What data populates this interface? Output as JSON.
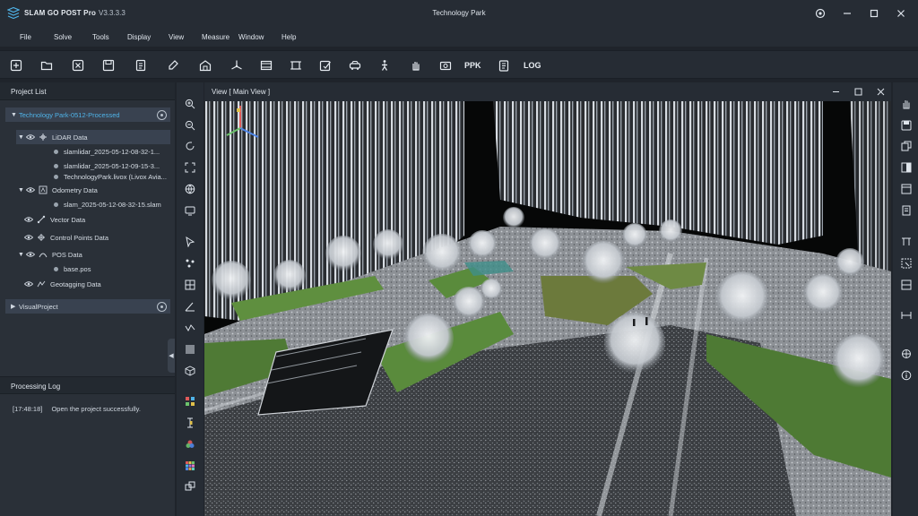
{
  "app": {
    "name": "SLAM GO POST Pro",
    "version": "V3.3.3.3",
    "window_title": "Technology Park"
  },
  "menu": [
    "File",
    "Solve",
    "Tools",
    "Display",
    "View",
    "Measure",
    "Window",
    "Help"
  ],
  "toolbar": {
    "icons": [
      "new-project-icon",
      "open-folder-icon",
      "close-project-icon",
      "save-icon",
      "import-icon",
      "edit-icon",
      "building-icon",
      "coordinate-axes-icon",
      "film-icon",
      "frame-icon",
      "notes-icon",
      "car-icon",
      "walker-icon",
      "hand-icon",
      "camera-icon",
      "clipboard-icon"
    ],
    "ppk_label": "PPK",
    "log_label": "LOG"
  },
  "project_panel": {
    "title": "Project List",
    "root": "Technology Park-0512-Processed",
    "groups": [
      {
        "label": "LiDAR Data",
        "items": [
          "slamlidar_2025-05-12-08-32-1...",
          "slamlidar_2025-05-12-09-15-3...",
          "TechnologyPark.livox (Livox Avia..."
        ]
      },
      {
        "label": "Odometry Data",
        "items": [
          "slam_2025-05-12-08-32-15.slam"
        ]
      },
      {
        "label": "Vector Data",
        "items": []
      },
      {
        "label": "Control Points Data",
        "items": []
      },
      {
        "label": "POS Data",
        "items": [
          "base.pos"
        ]
      },
      {
        "label": "Geotagging Data",
        "items": []
      }
    ],
    "second_root": "VisualProject"
  },
  "processing_log": {
    "title": "Processing Log",
    "entries": [
      {
        "time": "[17:48:18]",
        "message": "Open the project successfully."
      }
    ]
  },
  "view": {
    "title": "View [ Main View ]"
  },
  "colors": {
    "accent": "#4fb3e8",
    "background": "#1f242b",
    "panel": "#2a3038",
    "viewport": "#070808"
  }
}
